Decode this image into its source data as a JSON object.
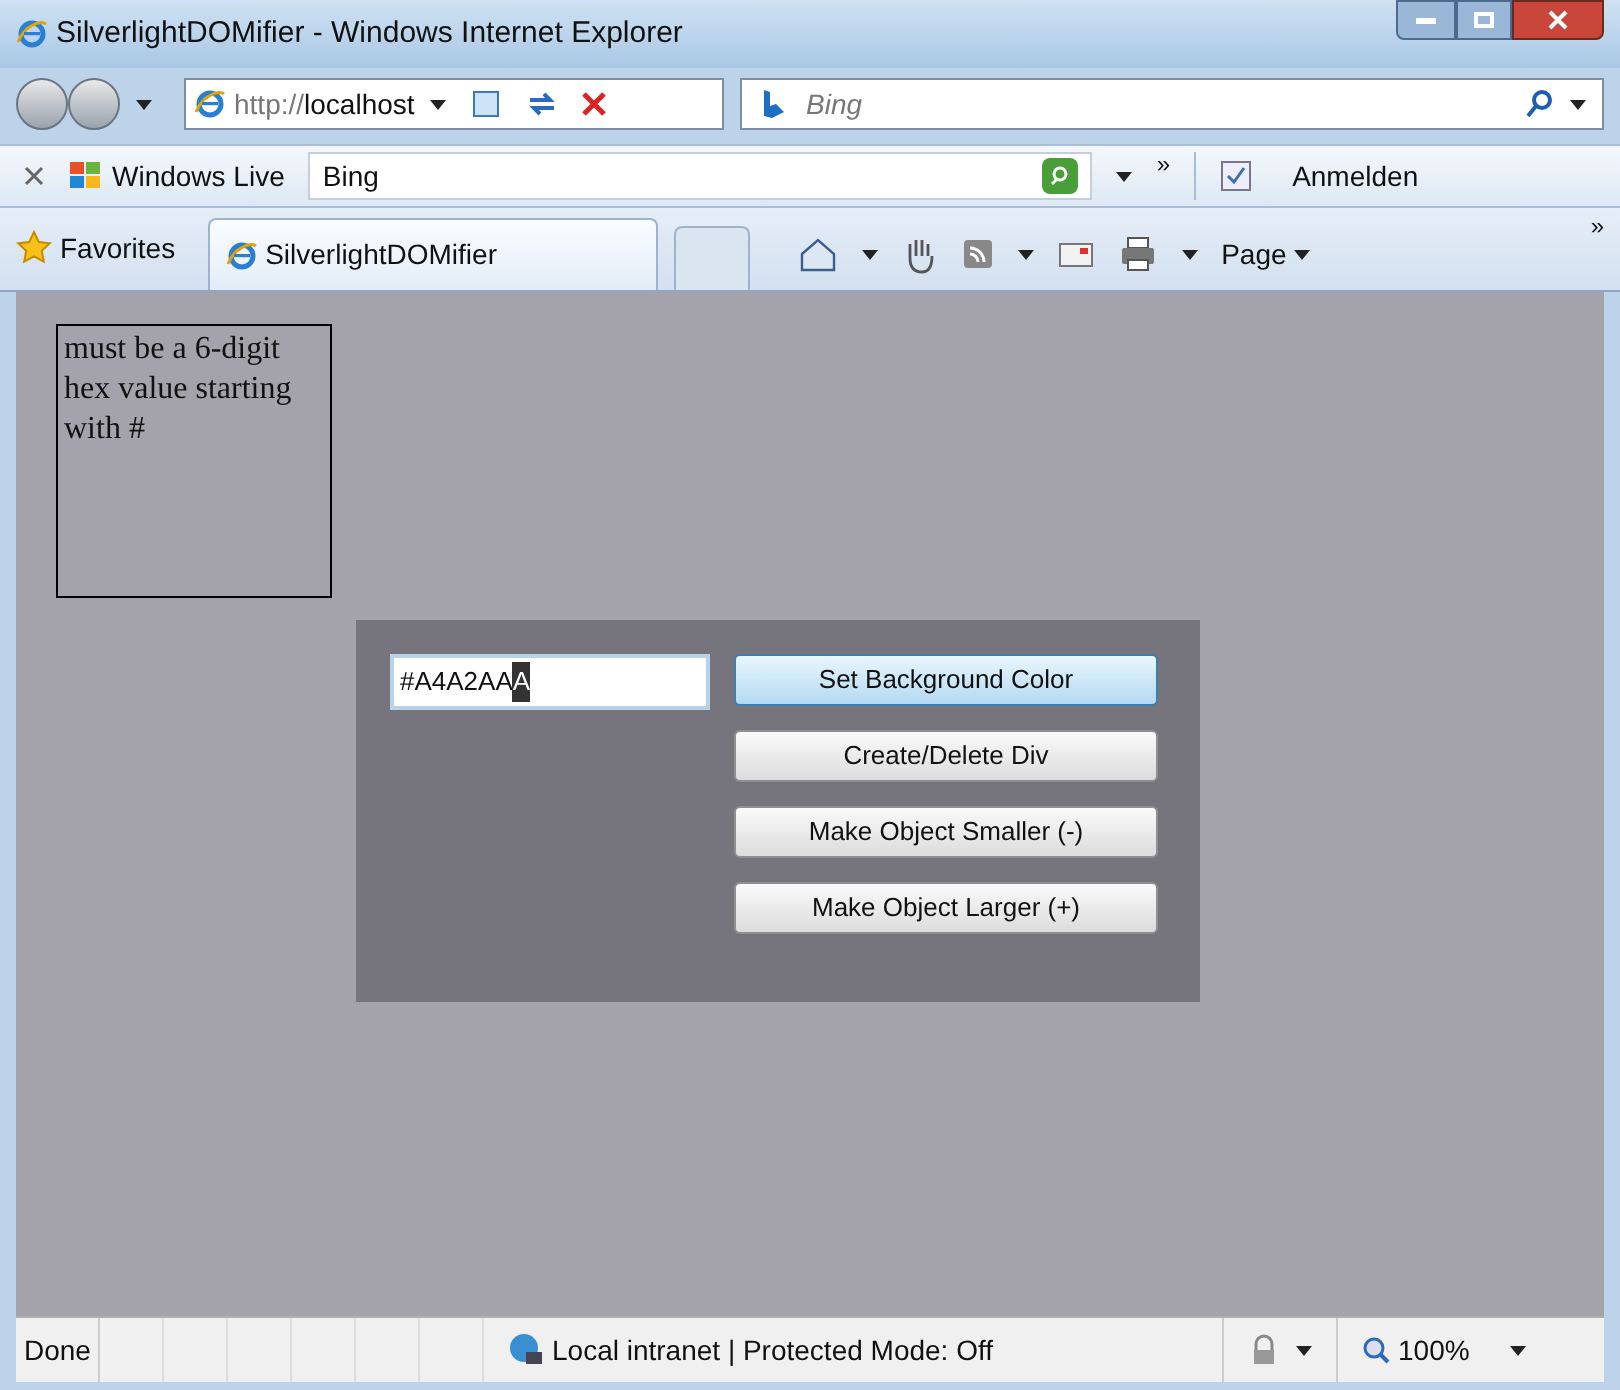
{
  "window": {
    "title": "SilverlightDOMifier - Windows Internet Explorer"
  },
  "address_bar": {
    "url_prefix": "http://",
    "url_host": "localhost"
  },
  "search": {
    "placeholder": "Bing"
  },
  "links_bar": {
    "brand": "Windows Live",
    "search_value": "Bing",
    "more": "»",
    "sign_in": "Anmelden"
  },
  "favorites_bar": {
    "favorites": "Favorites",
    "tabs": [
      {
        "label": "SilverlightDOMifier",
        "selected": true
      }
    ],
    "page_menu": "Page",
    "more": "»"
  },
  "page": {
    "message": "must be a 6-digit hex value starting with #",
    "color_field": {
      "value": "#A4A2AA",
      "selected_text": "A"
    },
    "buttons": [
      {
        "label": "Set Background Color",
        "hovered": true
      },
      {
        "label": "Create/Delete Div",
        "hovered": false
      },
      {
        "label": "Make Object Smaller (-)",
        "hovered": false
      },
      {
        "label": "Make Object Larger (+)",
        "hovered": false
      }
    ]
  },
  "status_bar": {
    "status": "Done",
    "zone": "Local intranet | Protected Mode: Off",
    "zoom": "100%"
  }
}
